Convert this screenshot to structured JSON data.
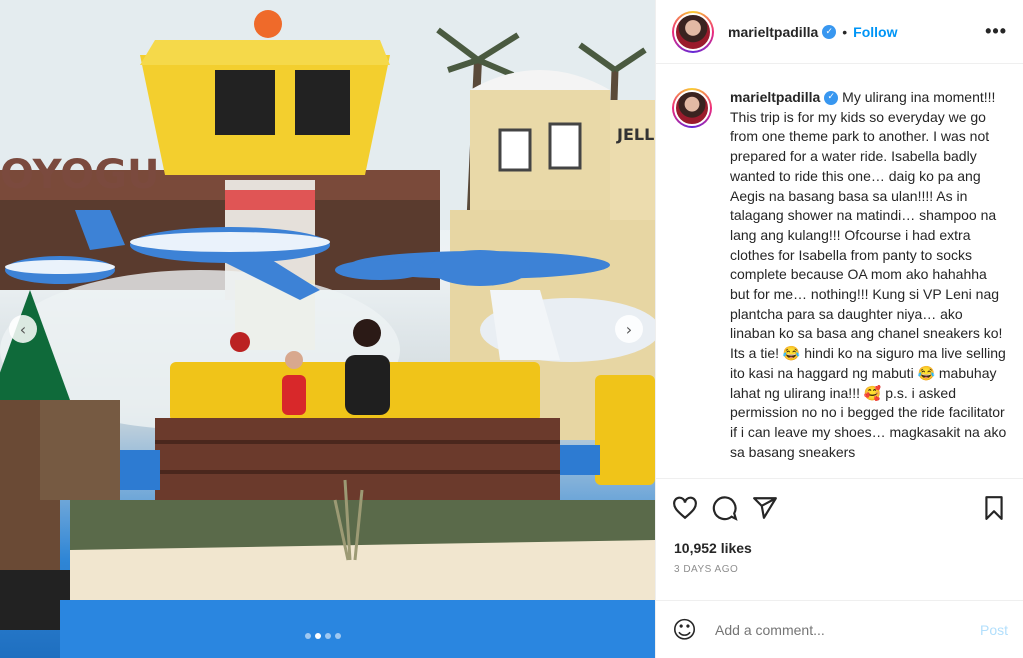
{
  "post": {
    "username": "marieltpadilla",
    "follow_label": "Follow",
    "separator": "•",
    "more_label": "•••",
    "caption": "My ulirang ina moment!!! This trip is for my kids so everyday we go from one theme park to another. I was not prepared for a water ride. Isabella badly wanted to ride this one… daig ko pa ang Aegis na basang basa sa ulan!!!! As in talagang shower na matindi… shampoo na lang ang kulang!!! Ofcourse i had extra clothes for Isabella from panty to socks complete because OA mom ako hahahha but for me… nothing!!! Kung si VP Leni nag plantcha para sa daughter niya… ako linaban ko sa basa ang chanel sneakers ko! Its a tie! 😂 hindi ko na siguro ma live selling ito kasi na haggard ng mabuti 😂 mabuhay lahat ng ulirang ina!!! 🥰 p.s. i asked permission no no i begged the ride facilitator if i can leave my shoes… magkasakit na ako sa basang sneakers",
    "likes": "10,952 likes",
    "time": "3 DAYS AGO"
  },
  "photo": {
    "sign_text": "OYOGU",
    "sign_text_right": "JELL",
    "nav_prev": "‹",
    "nav_next": "›",
    "slide_count": 4,
    "active_slide": 2
  },
  "comment": {
    "placeholder": "Add a comment...",
    "post_label": "Post"
  },
  "icons": {
    "like": "heart-icon",
    "comment": "comment-icon",
    "share": "share-icon",
    "save": "bookmark-icon",
    "emoji": "emoji-icon",
    "verified": "verified-badge-icon"
  },
  "colors": {
    "link": "#0095f6",
    "post_disabled": "#b2dffc",
    "secondary_text": "#8e8e8e"
  }
}
